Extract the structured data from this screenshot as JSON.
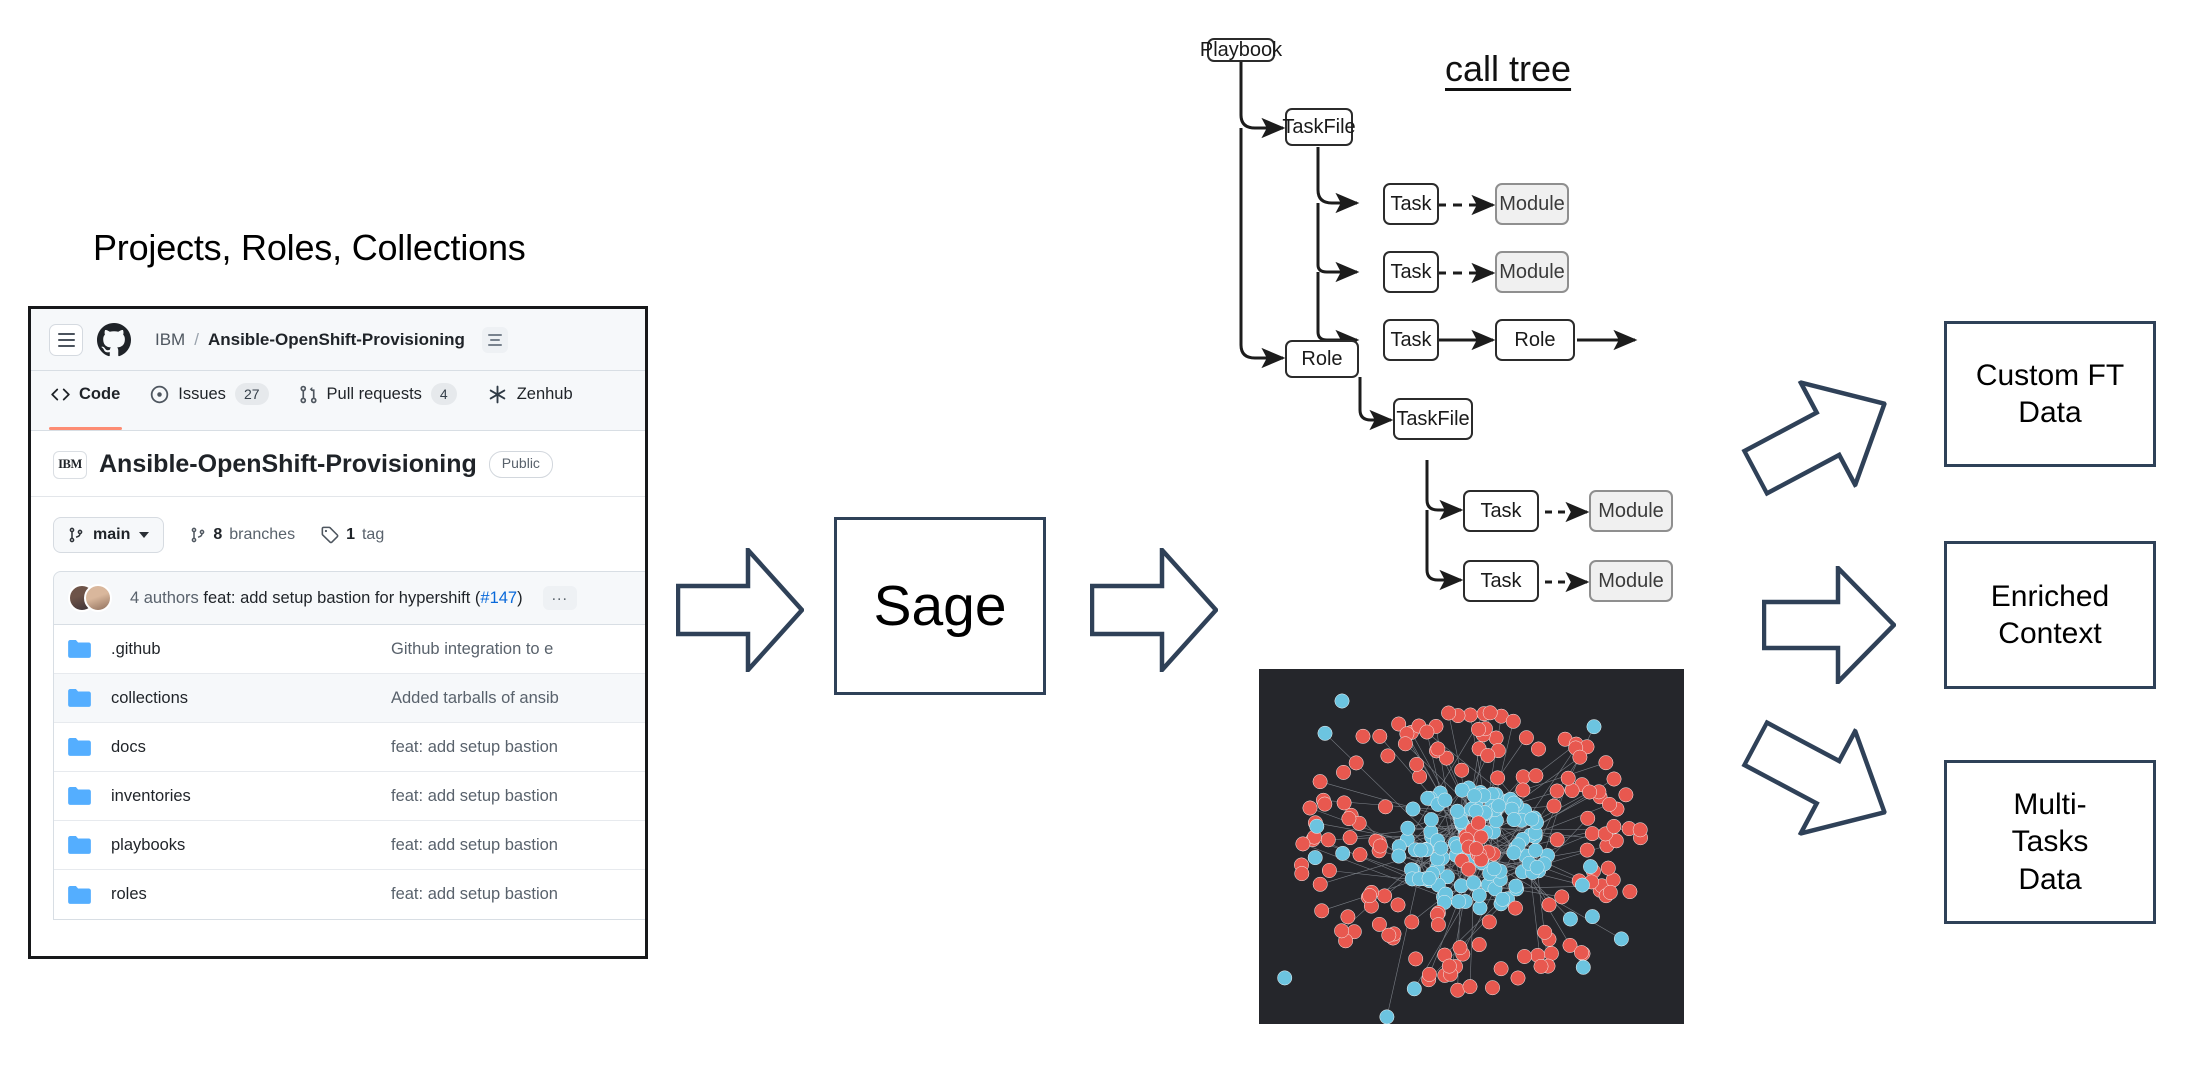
{
  "section": {
    "heading": "Projects, Roles, Collections"
  },
  "github": {
    "header": {
      "hamburger_icon": "hamburger-icon",
      "logo_icon": "github-mark-icon",
      "owner": "IBM",
      "separator": "/",
      "repo": "Ansible-OpenShift-Provisioning",
      "list_icon": "list-lines-icon"
    },
    "tabs": [
      {
        "label": "Code",
        "icon": "code-brackets-icon",
        "count": "",
        "active": true
      },
      {
        "label": "Issues",
        "icon": "issue-opened-icon",
        "count": "27",
        "active": false
      },
      {
        "label": "Pull requests",
        "icon": "git-pull-request-icon",
        "count": "4",
        "active": false
      },
      {
        "label": "Zenhub",
        "icon": "zenhub-asterisk-icon",
        "count": "",
        "active": false
      }
    ],
    "repo_header": {
      "org_logo_text": "IBM",
      "title": "Ansible-OpenShift-Provisioning",
      "visibility": "Public"
    },
    "branch_bar": {
      "branch_icon": "git-branch-icon",
      "branch": "main",
      "branches_count": "8",
      "branches_label": "branches",
      "tag_icon": "tag-icon",
      "tags_count": "1",
      "tags_label": "tag"
    },
    "commit_bar": {
      "avatar_icon": "avatar-stack",
      "authors": "4 authors",
      "message": "feat: add setup bastion for hypershift (",
      "pr_number": "#147",
      "message_close": ")",
      "overflow": "..."
    },
    "files": [
      {
        "icon": "folder-icon",
        "name": ".github",
        "message": "Github integration to e"
      },
      {
        "icon": "folder-icon",
        "name": "collections",
        "message": "Added tarballs of ansib"
      },
      {
        "icon": "folder-icon",
        "name": "docs",
        "message": "feat: add setup bastion"
      },
      {
        "icon": "folder-icon",
        "name": "inventories",
        "message": "feat: add setup bastion"
      },
      {
        "icon": "folder-icon",
        "name": "playbooks",
        "message": "feat: add setup bastion"
      },
      {
        "icon": "folder-icon",
        "name": "roles",
        "message": "feat: add setup bastion"
      }
    ]
  },
  "pipeline": {
    "arrow_in": "block-arrow-right",
    "sage": "Sage",
    "arrow_out": "block-arrow-right",
    "arrow_up": "block-arrow-up-right",
    "arrow_right": "block-arrow-right",
    "arrow_down": "block-arrow-down-right"
  },
  "call_tree": {
    "title": "call tree",
    "nodes": [
      {
        "id": "playbook",
        "label": "Playbook",
        "type": "normal"
      },
      {
        "id": "taskfile1",
        "label": "TaskFile",
        "type": "normal"
      },
      {
        "id": "task1",
        "label": "Task",
        "type": "normal"
      },
      {
        "id": "module1",
        "label": "Module",
        "type": "module"
      },
      {
        "id": "task2",
        "label": "Task",
        "type": "normal"
      },
      {
        "id": "module2",
        "label": "Module",
        "type": "module"
      },
      {
        "id": "task3",
        "label": "Task",
        "type": "normal"
      },
      {
        "id": "role1",
        "label": "Role",
        "type": "normal"
      },
      {
        "id": "role2",
        "label": "Role",
        "type": "normal"
      },
      {
        "id": "taskfile2",
        "label": "TaskFile",
        "type": "normal"
      },
      {
        "id": "task4",
        "label": "Task",
        "type": "normal"
      },
      {
        "id": "module3",
        "label": "Module",
        "type": "module"
      },
      {
        "id": "task5",
        "label": "Task",
        "type": "normal"
      },
      {
        "id": "module4",
        "label": "Module",
        "type": "module"
      }
    ]
  },
  "network_graph": {
    "name": "dependency-network-graph",
    "background": "#25262b",
    "node_colors": {
      "red": "#e8584f",
      "blue": "#6cc4e0"
    },
    "edge_color": "#9aa0a8"
  },
  "outputs": [
    {
      "label": "Custom FT\nData",
      "line1": "Custom FT",
      "line2": "Data",
      "line3": ""
    },
    {
      "label": "Enriched\nContext",
      "line1": "Enriched",
      "line2": "Context",
      "line3": ""
    },
    {
      "label": "Multi-\nTasks\nData",
      "line1": "Multi-",
      "line2": "Tasks",
      "line3": "Data"
    }
  ],
  "colors": {
    "accent_border": "#2f4158",
    "github_tab_active": "#fd8c73",
    "link": "#0969da"
  }
}
